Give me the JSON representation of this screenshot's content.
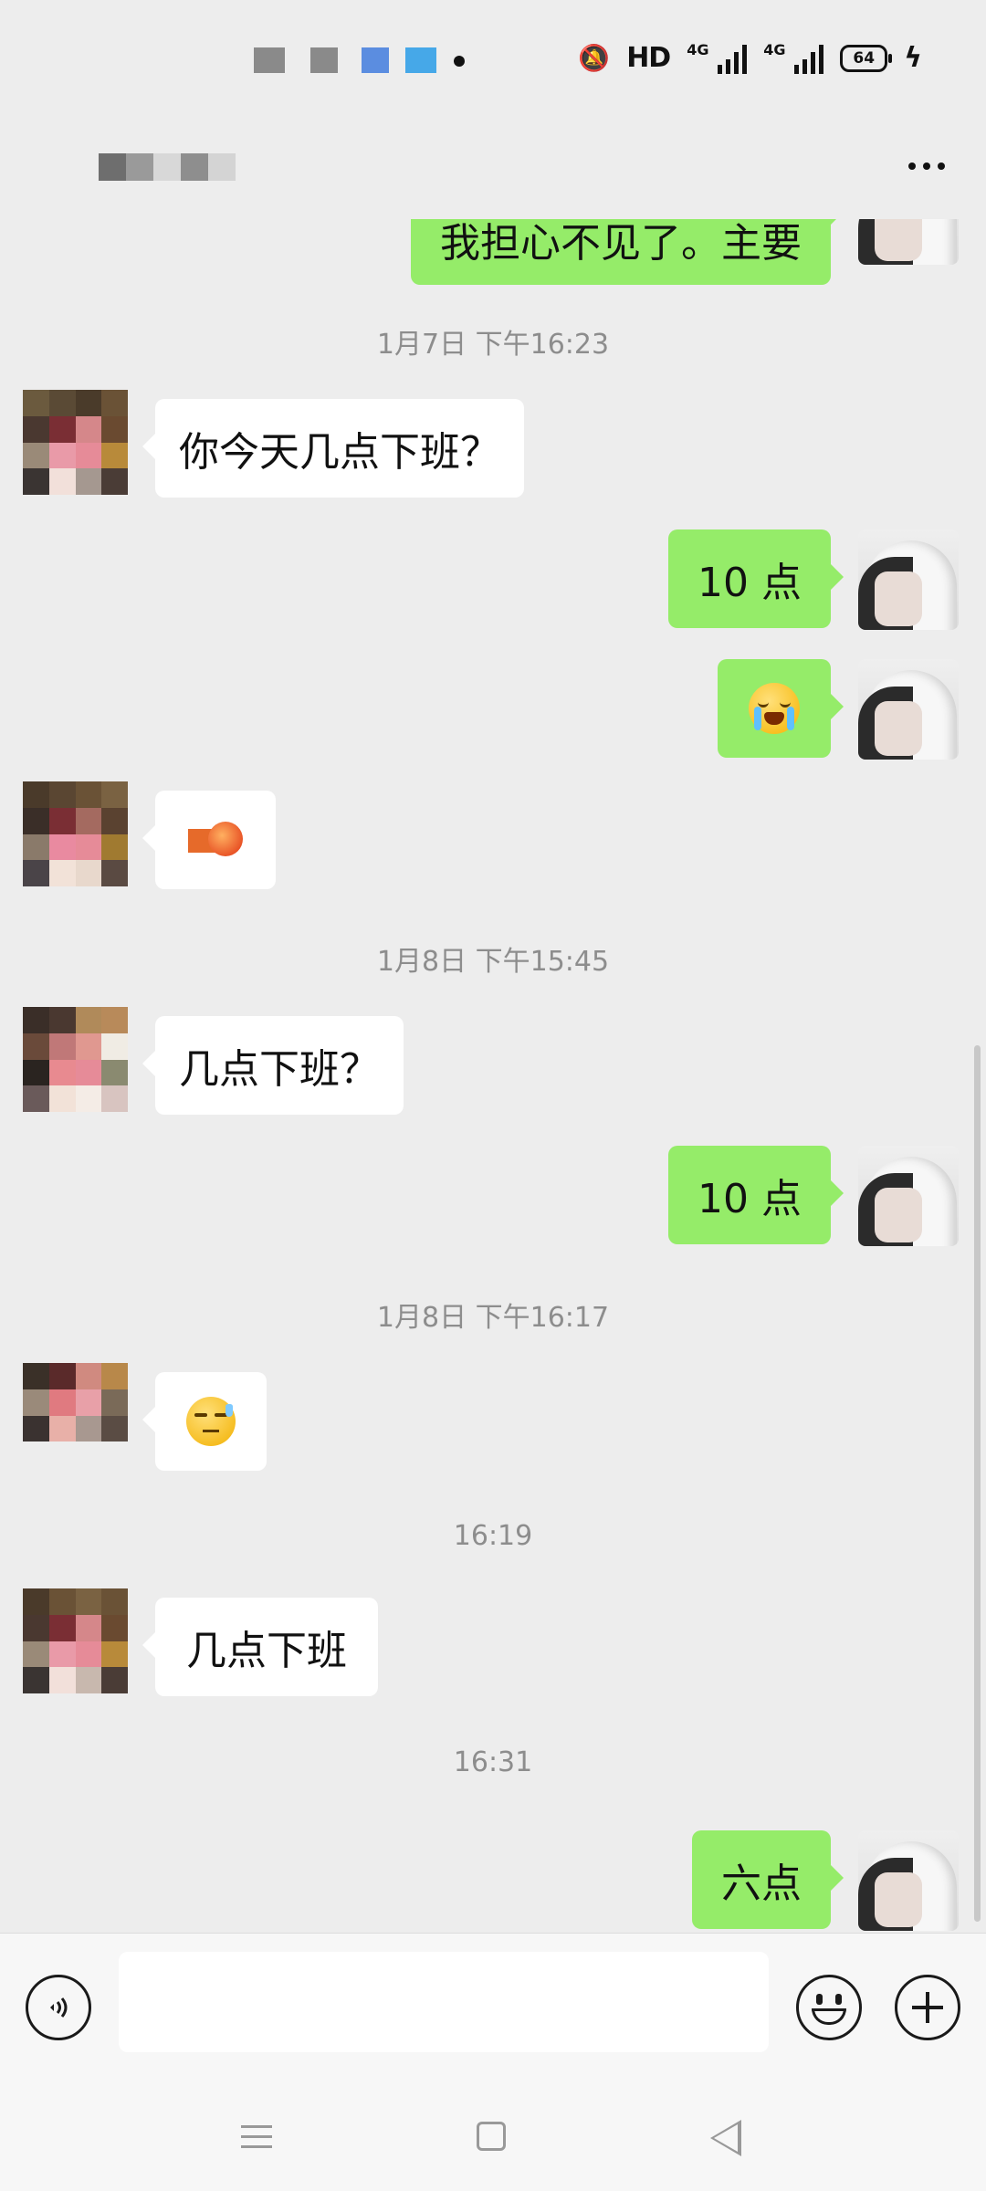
{
  "header": {
    "more_icon": "more-dots-icon"
  },
  "messages": {
    "top_partial": "我担心不见了。主要",
    "ts1": "1月7日 下午16:23",
    "m1": "你今天几点下班？",
    "m2": "10 点",
    "m3_emoji": "crying-face-emoji",
    "m4_sticker": "sticker-image",
    "ts2": "1月8日 下午15:45",
    "m5": "几点下班？",
    "m6": "10 点",
    "ts3": "1月8日 下午16:17",
    "m7_emoji": "eye-roll-sweat-emoji",
    "ts4": "16:19",
    "m8": "几点下班",
    "ts5": "16:31",
    "m9": "六点"
  },
  "status_bar": {
    "hd": "HD",
    "net1": "4G",
    "net2": "4G",
    "battery": "64"
  },
  "input": {
    "value": ""
  },
  "colors": {
    "sent_bubble": "#95ec69",
    "received_bubble": "#ffffff",
    "background": "#ededed"
  }
}
